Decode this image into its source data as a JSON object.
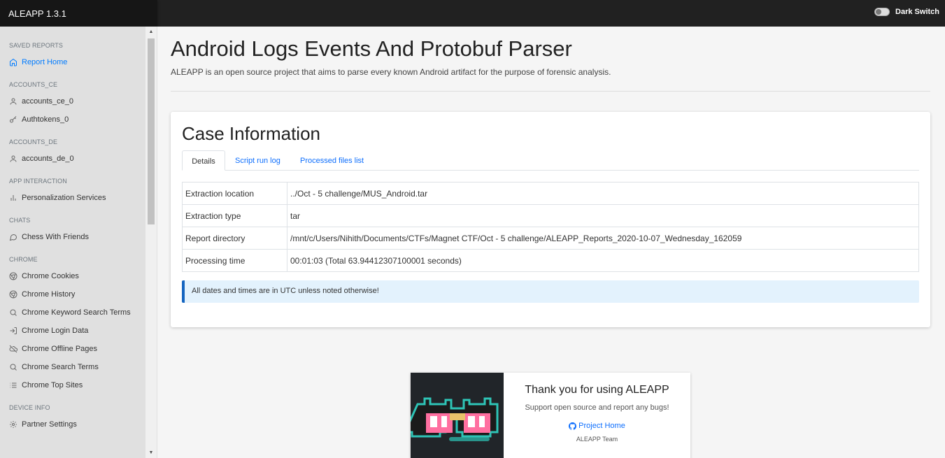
{
  "app": {
    "title": "ALEAPP 1.3.1"
  },
  "header": {
    "dark_switch_label": "Dark Switch"
  },
  "sidebar": {
    "sections": [
      {
        "title": "SAVED REPORTS",
        "items": [
          {
            "label": "Report Home",
            "icon": "home-icon",
            "active": true
          }
        ]
      },
      {
        "title": "ACCOUNTS_CE",
        "items": [
          {
            "label": "accounts_ce_0",
            "icon": "user-icon"
          },
          {
            "label": "Authtokens_0",
            "icon": "key-icon"
          }
        ]
      },
      {
        "title": "ACCOUNTS_DE",
        "items": [
          {
            "label": "accounts_de_0",
            "icon": "user-icon"
          }
        ]
      },
      {
        "title": "APP INTERACTION",
        "items": [
          {
            "label": "Personalization Services",
            "icon": "bar-chart-icon"
          }
        ]
      },
      {
        "title": "CHATS",
        "items": [
          {
            "label": "Chess With Friends",
            "icon": "message-circle-icon"
          }
        ]
      },
      {
        "title": "CHROME",
        "items": [
          {
            "label": "Chrome Cookies",
            "icon": "chrome-icon"
          },
          {
            "label": "Chrome History",
            "icon": "chrome-icon"
          },
          {
            "label": "Chrome Keyword Search Terms",
            "icon": "search-icon"
          },
          {
            "label": "Chrome Login Data",
            "icon": "log-in-icon"
          },
          {
            "label": "Chrome Offline Pages",
            "icon": "cloud-off-icon"
          },
          {
            "label": "Chrome Search Terms",
            "icon": "search-icon"
          },
          {
            "label": "Chrome Top Sites",
            "icon": "list-icon"
          }
        ]
      },
      {
        "title": "DEVICE INFO",
        "items": [
          {
            "label": "Partner Settings",
            "icon": "settings-icon"
          }
        ]
      }
    ]
  },
  "main": {
    "title": "Android Logs Events And Protobuf Parser",
    "subtitle": "ALEAPP is an open source project that aims to parse every known Android artifact for the purpose of forensic analysis."
  },
  "case": {
    "title": "Case Information",
    "tabs": [
      "Details",
      "Script run log",
      "Processed files list"
    ],
    "rows": [
      {
        "key": "Extraction location",
        "value": "../Oct - 5 challenge/MUS_Android.tar"
      },
      {
        "key": "Extraction type",
        "value": "tar"
      },
      {
        "key": "Report directory",
        "value": "/mnt/c/Users/Nihith/Documents/CTFs/Magnet CTF/Oct - 5 challenge/ALEAPP_Reports_2020-10-07_Wednesday_162059"
      },
      {
        "key": "Processing time",
        "value": "00:01:03 (Total 63.94412307100001 seconds)"
      }
    ],
    "alert": "All dates and times are in UTC unless noted otherwise!"
  },
  "footer": {
    "title": "Thank you for using ALEAPP",
    "subtitle": "Support open source and report any bugs!",
    "link": "Project Home",
    "team": "ALEAPP Team"
  },
  "colors": {
    "accent": "#007bff",
    "alert_border": "#1565c0",
    "alert_bg": "#e3f2fd",
    "topbar": "#212121"
  }
}
